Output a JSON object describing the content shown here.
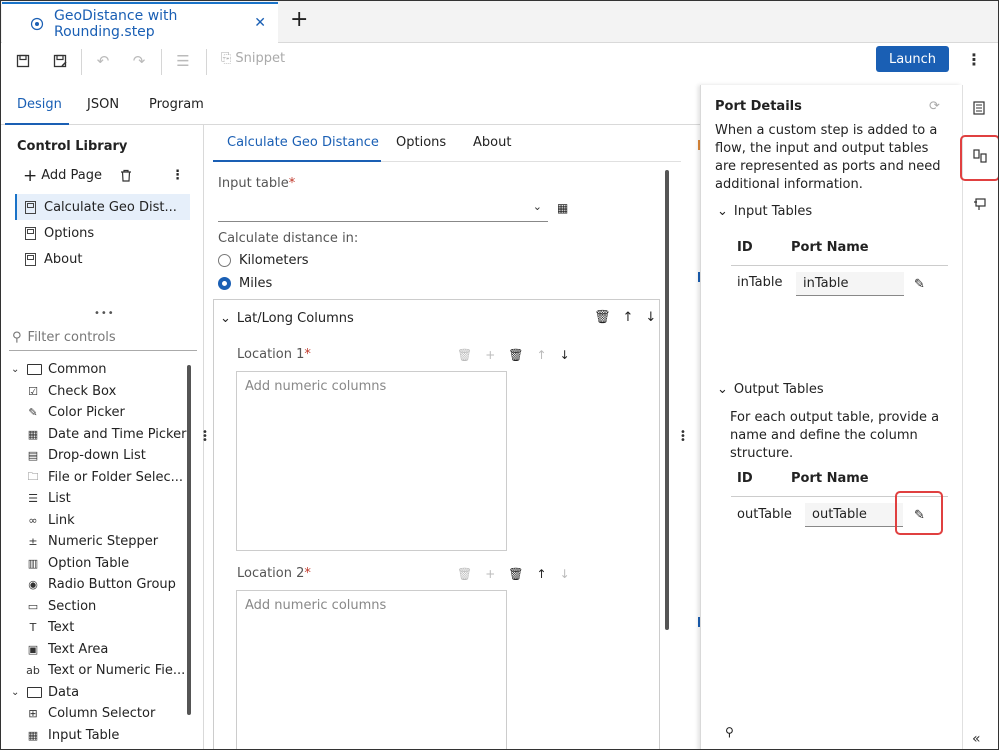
{
  "file_tab": {
    "title": "GeoDistance with Rounding.step",
    "close": "✕",
    "new_tab": "+"
  },
  "toolbar": {
    "snippet_label": "Snippet",
    "launch_label": "Launch"
  },
  "main_tabs": [
    "Design",
    "JSON",
    "Program"
  ],
  "control_library": {
    "title": "Control Library",
    "add_page": "Add Page",
    "pages": [
      "Calculate Geo Dist...",
      "Options",
      "About"
    ],
    "filter_placeholder": "Filter controls",
    "groups": [
      {
        "name": "Common",
        "items": [
          "Check Box",
          "Color Picker",
          "Date and Time Picker",
          "Drop-down List",
          "File or Folder Selec...",
          "List",
          "Link",
          "Numeric Stepper",
          "Option Table",
          "Radio Button Group",
          "Section",
          "Text",
          "Text Area",
          "Text or Numeric Fie..."
        ]
      },
      {
        "name": "Data",
        "items": [
          "Column Selector",
          "Input Table"
        ]
      }
    ]
  },
  "center": {
    "tabs": [
      "Calculate Geo Distance",
      "Options",
      "About"
    ],
    "input_table_label": "Input table",
    "required_mark": "*",
    "distance_label": "Calculate distance in:",
    "radio_options": [
      {
        "label": "Kilometers",
        "selected": false
      },
      {
        "label": "Miles",
        "selected": true
      }
    ],
    "section_title": "Lat/Long Columns",
    "location1_label": "Location  1",
    "location2_label": "Location 2",
    "add_columns_placeholder": "Add numeric columns"
  },
  "port_details": {
    "title": "Port Details",
    "description": "When a custom step is added to a flow, the input and output tables are represented as ports and need additional information.",
    "input_tables_label": "Input Tables",
    "output_tables_label": "Output Tables",
    "output_description": "For each output table, provide a name and define the column structure.",
    "col_id": "ID",
    "col_port_name": "Port Name",
    "input_row": {
      "id": "inTable",
      "port_name": "inTable"
    },
    "output_row": {
      "id": "outTable",
      "port_name": "outTable"
    }
  },
  "colors": {
    "accent": "#1a5fb4",
    "highlight": "#e04040",
    "selection_bg": "#e6effa"
  }
}
